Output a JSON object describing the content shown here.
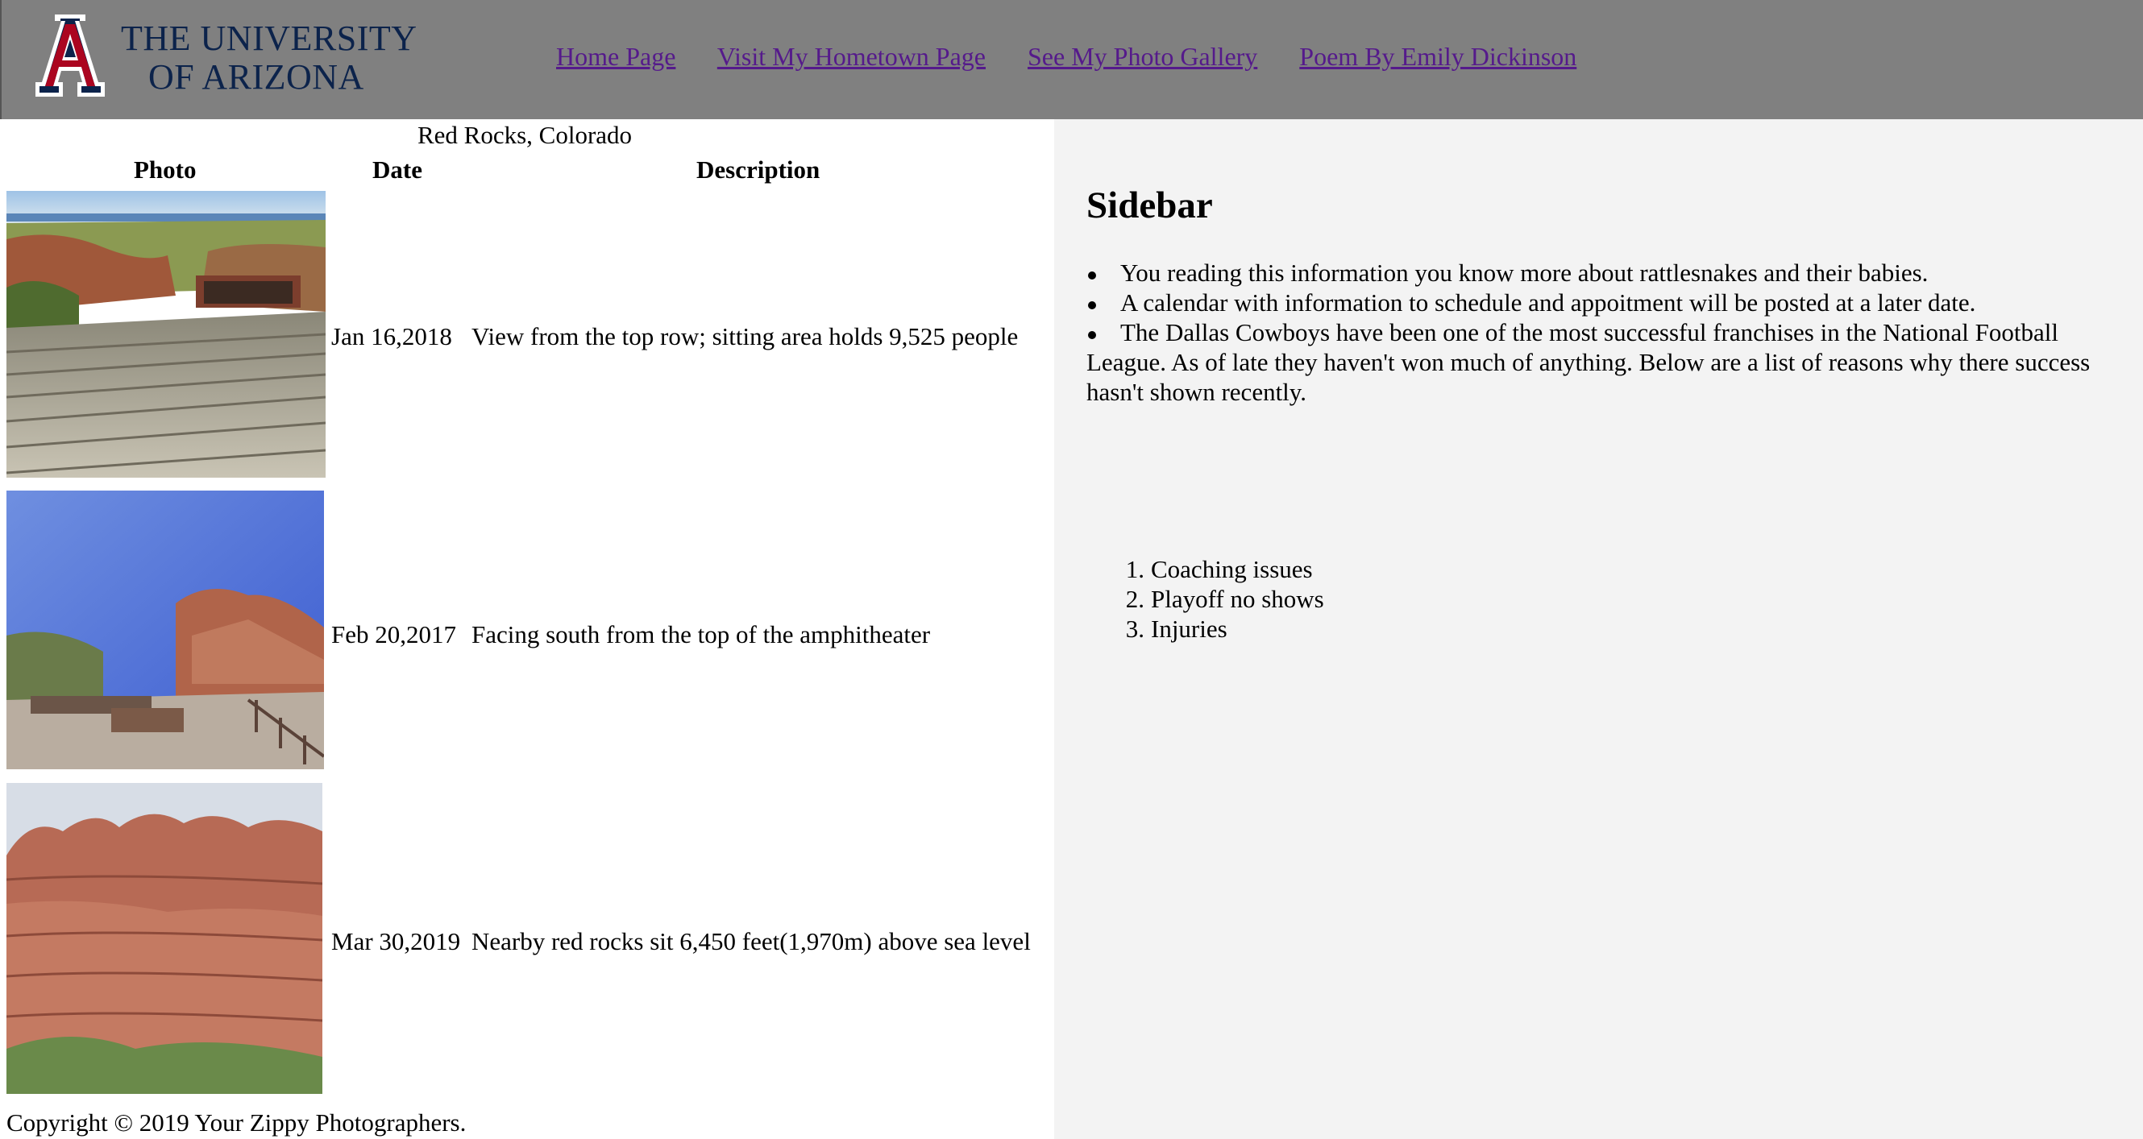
{
  "header": {
    "logo_line1": "THE UNIVERSITY",
    "logo_line2": "OF ARIZONA",
    "brand_color": "#0c234b",
    "accent_color": "#ab0520",
    "nav": [
      {
        "label": "Home Page"
      },
      {
        "label": "Visit My Hometown Page"
      },
      {
        "label": "See My Photo Gallery"
      },
      {
        "label": "Poem By Emily Dickinson"
      }
    ]
  },
  "gallery": {
    "caption": "Red Rocks, Colorado",
    "columns": [
      "Photo",
      "Date",
      "Description"
    ],
    "rows": [
      {
        "date": "Jan 16,2018",
        "description": "View from the top row; sitting area holds 9,525 people",
        "photo": "amphitheater-top-row-photo"
      },
      {
        "date": "Feb 20,2017",
        "description": "Facing south from the top of the amphitheater",
        "photo": "amphitheater-south-photo"
      },
      {
        "date": "Mar 30,2019",
        "description": "Nearby red rocks sit 6,450 feet(1,970m) above sea level",
        "photo": "red-rocks-cliff-photo"
      }
    ]
  },
  "sidebar": {
    "title": "Sidebar",
    "bullets": [
      "You reading this information you know more about rattlesnakes and their babies.",
      "A calendar with information to schedule and appoitment will be posted at a later date.",
      "The Dallas Cowboys have been one of the most successful franchises in the National Football League. As of late they haven't won much of anything. Below are a list of reasons why there success hasn't shown recently."
    ],
    "reasons": [
      "Coaching issues",
      "Playoff no shows",
      "Injuries"
    ]
  },
  "footer": {
    "copyright": "Copyright © 2019 Your Zippy Photographers."
  }
}
